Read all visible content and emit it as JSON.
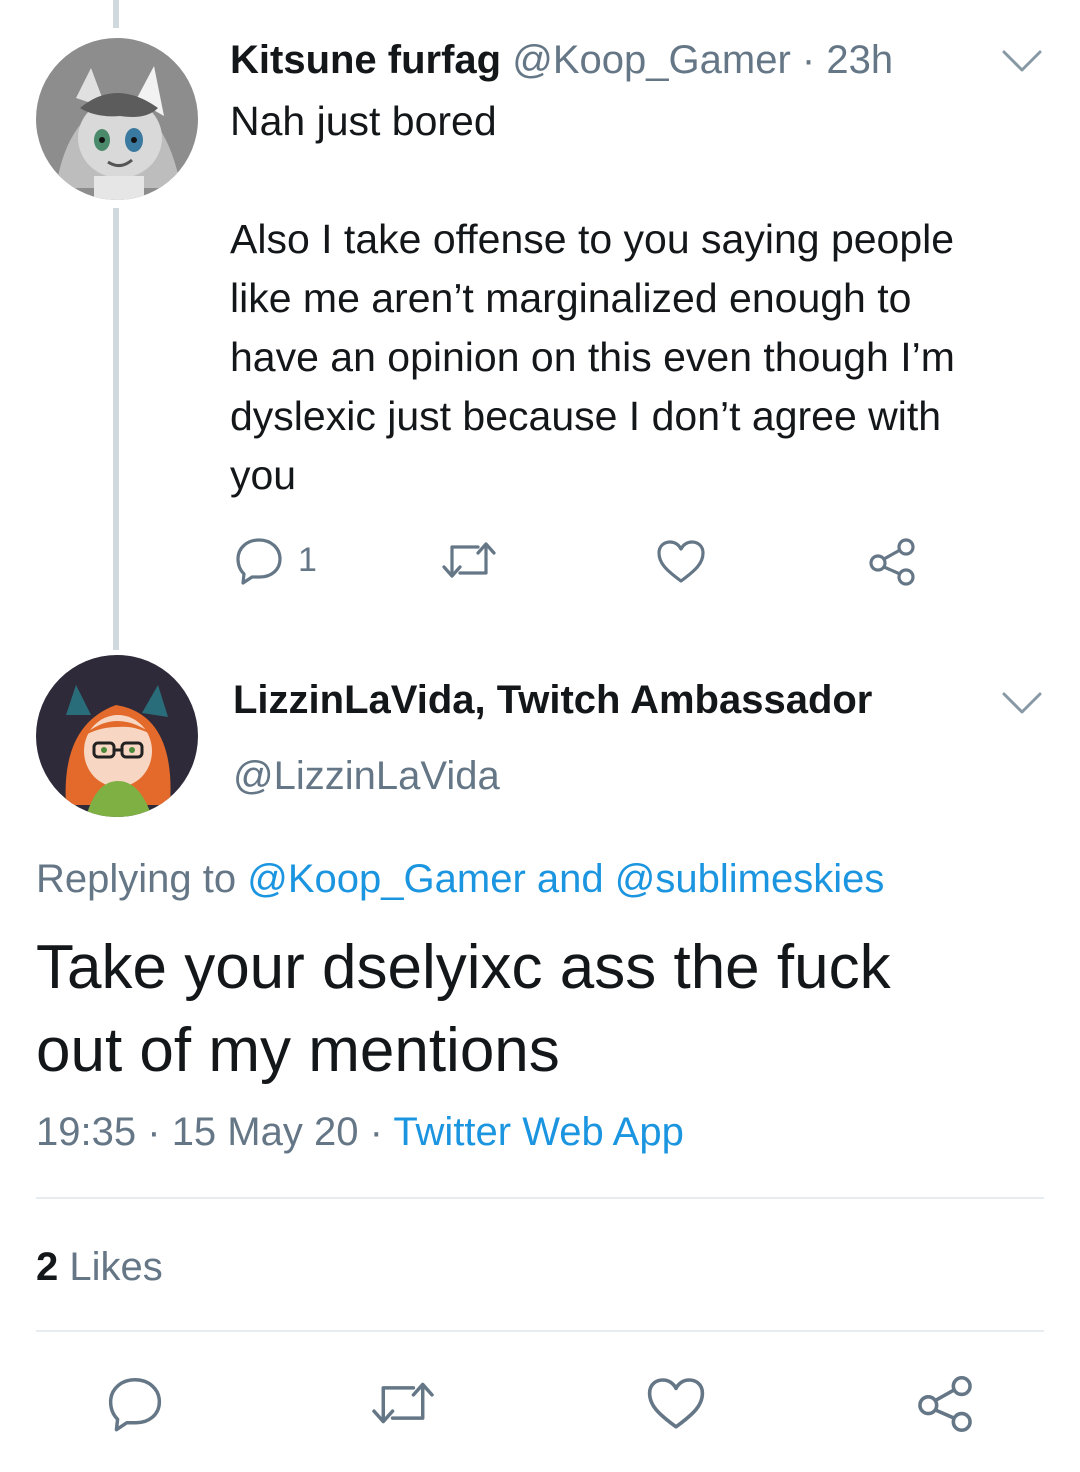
{
  "parent_tweet": {
    "display_name": "Kitsune furfag",
    "handle": "@Koop_Gamer",
    "separator": "·",
    "time": "23h",
    "text": "Nah just bored\n\nAlso I take offense to you saying people\nlike me aren’t marginalized enough to\nhave an opinion on this even though I’m\ndyslexic just because I don’t agree with\nyou",
    "reply_count": "1"
  },
  "main_tweet": {
    "display_name": "LizzinLaVida, Twitch Ambassador",
    "handle": "@LizzinLaVida",
    "replying_prefix": "Replying to",
    "replying_user_1": "@Koop_Gamer",
    "replying_and": "and",
    "replying_user_2": "@sublimeskies",
    "text": "Take your dselyixc ass the fuck\nout of my mentions",
    "time": "19:35",
    "sep1": "·",
    "date": "15 May 20",
    "sep2": "·",
    "source": "Twitter Web App",
    "likes_count": "2",
    "likes_label": "Likes"
  },
  "colors": {
    "text": "#14171a",
    "muted": "#657786",
    "link": "#1b95e0",
    "thread_line": "#cfd9de",
    "divider": "#e6ecf0"
  },
  "icons": [
    "chevron-down-icon",
    "reply-icon",
    "retweet-icon",
    "like-icon",
    "share-icon"
  ]
}
